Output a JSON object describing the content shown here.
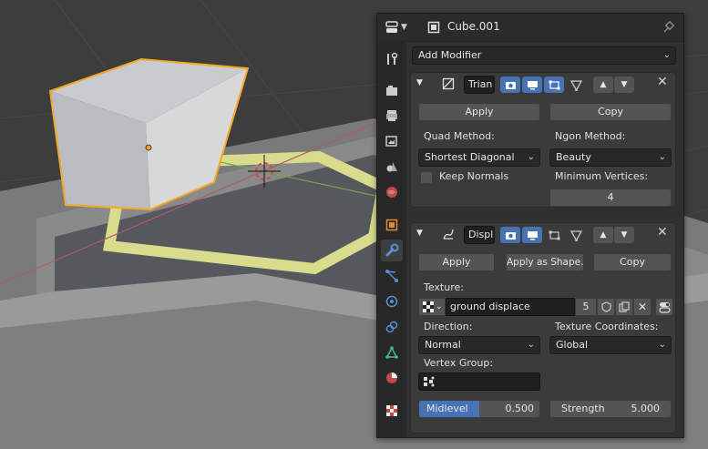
{
  "header": {
    "object_name": "Cube.001"
  },
  "add_modifier": {
    "label": "Add Modifier"
  },
  "triangulate": {
    "name": "Trian",
    "apply_label": "Apply",
    "copy_label": "Copy",
    "quad_method_label": "Quad Method:",
    "quad_method_value": "Shortest Diagonal",
    "ngon_method_label": "Ngon Method:",
    "ngon_method_value": "Beauty",
    "keep_normals_label": "Keep Normals",
    "keep_normals_checked": false,
    "min_vertices_label": "Minimum Vertices:",
    "min_vertices_value": "4"
  },
  "displace": {
    "name": "Displ",
    "apply_label": "Apply",
    "apply_shape_label": "Apply as Shape..",
    "copy_label": "Copy",
    "texture_label": "Texture:",
    "texture_name": "ground displace",
    "texture_users": "5",
    "direction_label": "Direction:",
    "direction_value": "Normal",
    "texture_coords_label": "Texture Coordinates:",
    "texture_coords_value": "Global",
    "vertex_group_label": "Vertex Group:",
    "midlevel_label": "Midlevel",
    "midlevel_value": "0.500",
    "midlevel_fraction": 0.5,
    "strength_label": "Strength",
    "strength_value": "5.000"
  },
  "colors": {
    "accent": "#4772b3",
    "selection": "#f5a623"
  }
}
